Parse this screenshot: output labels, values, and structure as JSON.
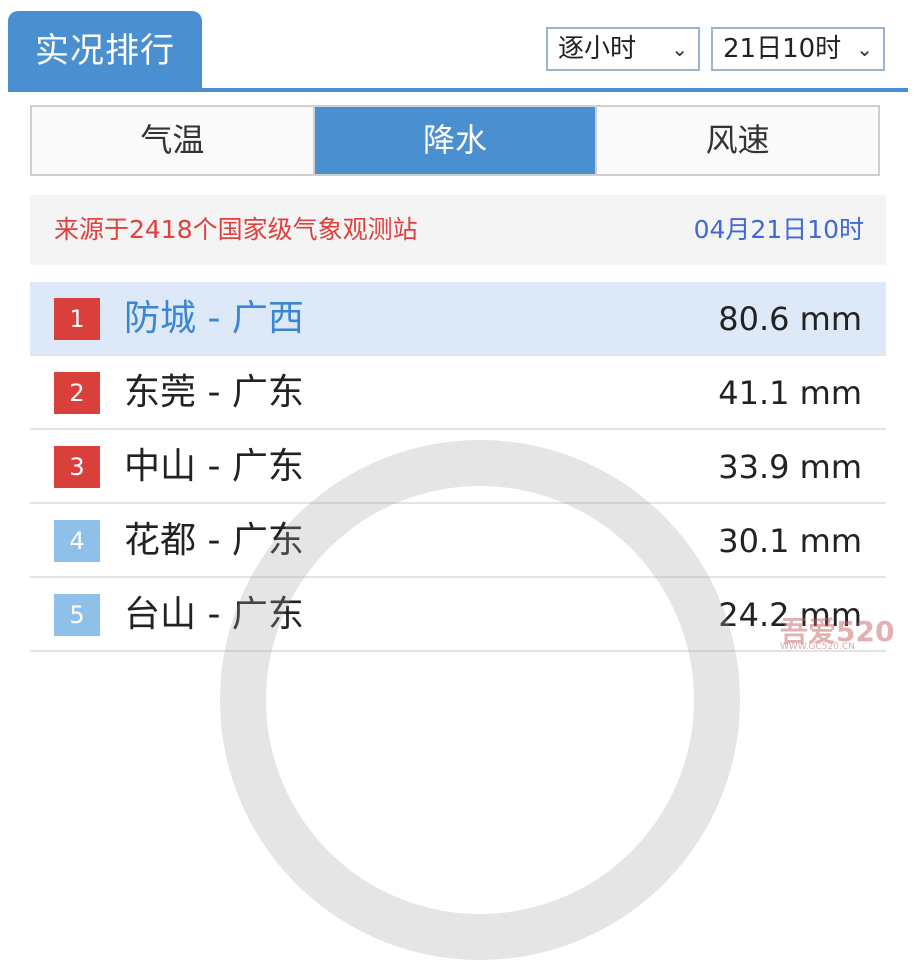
{
  "header": {
    "title": "实况排行",
    "mode_select": "逐小时",
    "time_select": "21日10时"
  },
  "tabs": [
    {
      "label": "气温",
      "active": false
    },
    {
      "label": "降水",
      "active": true
    },
    {
      "label": "风速",
      "active": false
    }
  ],
  "source": {
    "text": "来源于2418个国家级气象观测站",
    "time": "04月21日10时"
  },
  "rankings": [
    {
      "rank": "1",
      "name": "防城 - 广西",
      "value": "80.6 mm"
    },
    {
      "rank": "2",
      "name": "东莞 - 广东",
      "value": "41.1 mm"
    },
    {
      "rank": "3",
      "name": "中山 - 广东",
      "value": "33.9 mm"
    },
    {
      "rank": "4",
      "name": "花都 - 广东",
      "value": "30.1 mm"
    },
    {
      "rank": "5",
      "name": "台山 - 广东",
      "value": "24.2 mm"
    }
  ],
  "watermark": {
    "logo_text": "吾爱520",
    "sub_text": "WWW.GC520.CN"
  },
  "colors": {
    "accent": "#4a90d0",
    "rank_top": "#d9403c",
    "rank_other": "#8fc0ea",
    "highlight_row": "#dde9f8",
    "source_text": "#e0413e",
    "source_time": "#3f68d8"
  }
}
